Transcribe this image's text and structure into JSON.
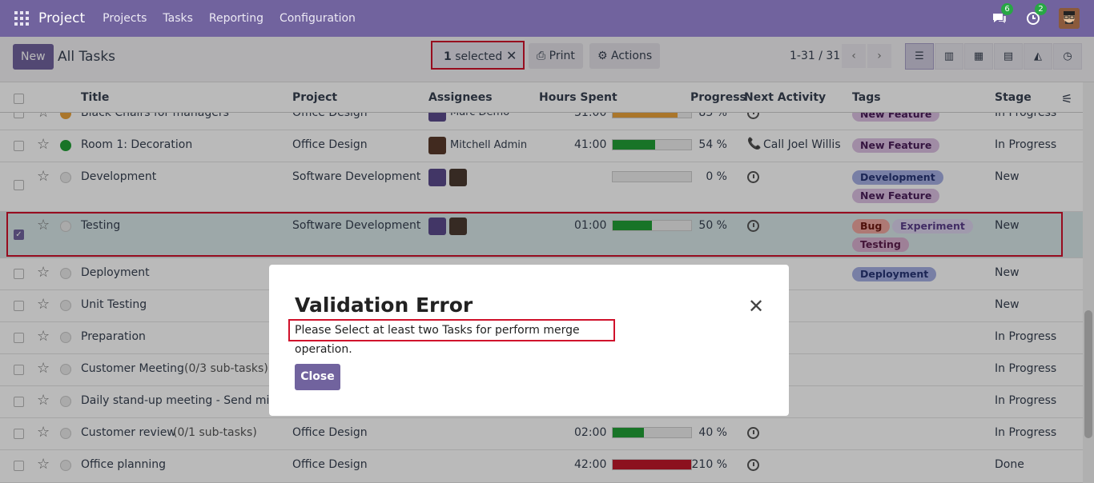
{
  "app": {
    "name": "Project",
    "menu": [
      "Projects",
      "Tasks",
      "Reporting",
      "Configuration"
    ],
    "chat_badge": "6",
    "activity_badge": "2"
  },
  "control": {
    "new_label": "New",
    "title": "All Tasks",
    "selected_count": "1",
    "selected_label": "selected",
    "print_label": "Print",
    "actions_label": "Actions",
    "pager": "1-31 / 31"
  },
  "columns": {
    "title": "Title",
    "project": "Project",
    "assignees": "Assignees",
    "hours": "Hours Spent",
    "progress": "Progress",
    "next_activity": "Next Activity",
    "tags": "Tags",
    "stage": "Stage"
  },
  "rows": [
    {
      "title": "Black Chairs for managers",
      "project": "Office Design",
      "assignee": "Marc Demo",
      "hours": "31:00",
      "progress": 0.83,
      "pct": "83 %",
      "tags": [
        "New Feature"
      ],
      "stage": "In Progress"
    },
    {
      "title": "Room 1: Decoration",
      "project": "Office Design",
      "assignee": "Mitchell Admin",
      "hours": "41:00",
      "progress": 0.54,
      "pct": "54 %",
      "activity": "Call Joel Willis",
      "tags": [
        "New Feature"
      ],
      "stage": "In Progress"
    },
    {
      "title": "Development",
      "project": "Software Development",
      "hours": "",
      "progress": 0,
      "pct": "0 %",
      "tags": [
        "Development",
        "New Feature"
      ],
      "stage": "New"
    },
    {
      "title": "Testing",
      "project": "Software Development",
      "hours": "01:00",
      "progress": 0.5,
      "pct": "50 %",
      "tags": [
        "Bug",
        "Experiment",
        "Testing"
      ],
      "stage": "New"
    },
    {
      "title": "Deployment",
      "tags": [
        "Deployment"
      ],
      "stage": "New"
    },
    {
      "title": "Unit Testing",
      "stage": "New"
    },
    {
      "title": "Preparation",
      "stage": "In Progress"
    },
    {
      "title": "Customer Meeting",
      "subtasks": "(0/3 sub-tasks)",
      "stage": "In Progress"
    },
    {
      "title": "Daily stand-up meeting - Send minute",
      "stage": "In Progress"
    },
    {
      "title": "Customer review",
      "subtasks": "(0/1 sub-tasks)",
      "project": "Office Design",
      "hours": "02:00",
      "progress": 0.4,
      "pct": "40 %",
      "stage": "In Progress"
    },
    {
      "title": "Office planning",
      "project": "Office Design",
      "hours": "42:00",
      "progress": 1.0,
      "pct": "210 %",
      "stage": "Done"
    }
  ],
  "colors": {
    "brand": "#71639e",
    "progress_green": "#21a036",
    "progress_red": "#c0182a",
    "progress_yellow": "#e9a23b"
  },
  "dialog": {
    "title": "Validation Error",
    "message": "Please Select at least two Tasks for perform merge operation.",
    "close_label": "Close"
  }
}
